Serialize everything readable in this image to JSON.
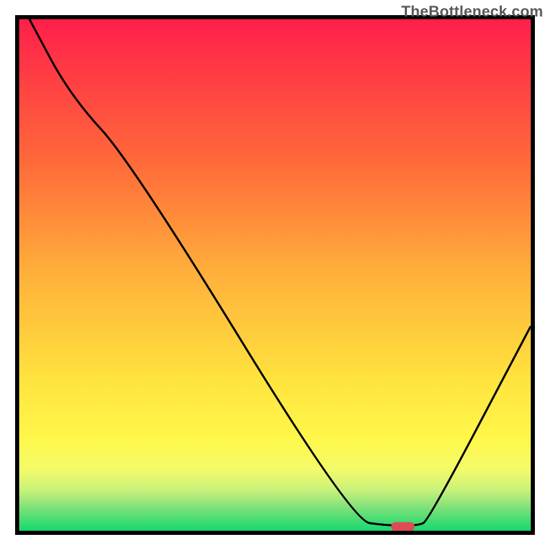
{
  "watermark": "TheBottleneck.com",
  "chart_data": {
    "type": "line",
    "title": "",
    "xlabel": "",
    "ylabel": "",
    "xlim": [
      0,
      100
    ],
    "ylim": [
      0,
      100
    ],
    "grid": false,
    "legend": false,
    "annotations": [
      {
        "name": "watermark",
        "text": "TheBottleneck.com",
        "position": "top-right"
      }
    ],
    "background": {
      "type": "vertical-gradient",
      "stops": [
        {
          "pct": 0,
          "color": "#ff1f4a"
        },
        {
          "pct": 28,
          "color": "#ff6a3a"
        },
        {
          "pct": 50,
          "color": "#ffb13b"
        },
        {
          "pct": 70,
          "color": "#ffe23e"
        },
        {
          "pct": 82,
          "color": "#fff74a"
        },
        {
          "pct": 88,
          "color": "#f4fa6a"
        },
        {
          "pct": 92,
          "color": "#c9f27a"
        },
        {
          "pct": 95,
          "color": "#8ae27a"
        },
        {
          "pct": 100,
          "color": "#14d96f"
        }
      ]
    },
    "series": [
      {
        "name": "bottleneck-curve",
        "x": [
          2,
          10,
          22,
          65,
          72,
          78,
          80,
          100
        ],
        "values": [
          100,
          85,
          72,
          2,
          1,
          1,
          2,
          40
        ]
      }
    ],
    "marker": {
      "name": "optimal-point",
      "x": 75,
      "y": 0.8,
      "color": "#e04a55",
      "shape": "rounded-bar"
    }
  },
  "frame": {
    "stroke": "#000000",
    "stroke_width": 6
  },
  "curve": {
    "stroke": "#000000",
    "stroke_width": 3
  }
}
